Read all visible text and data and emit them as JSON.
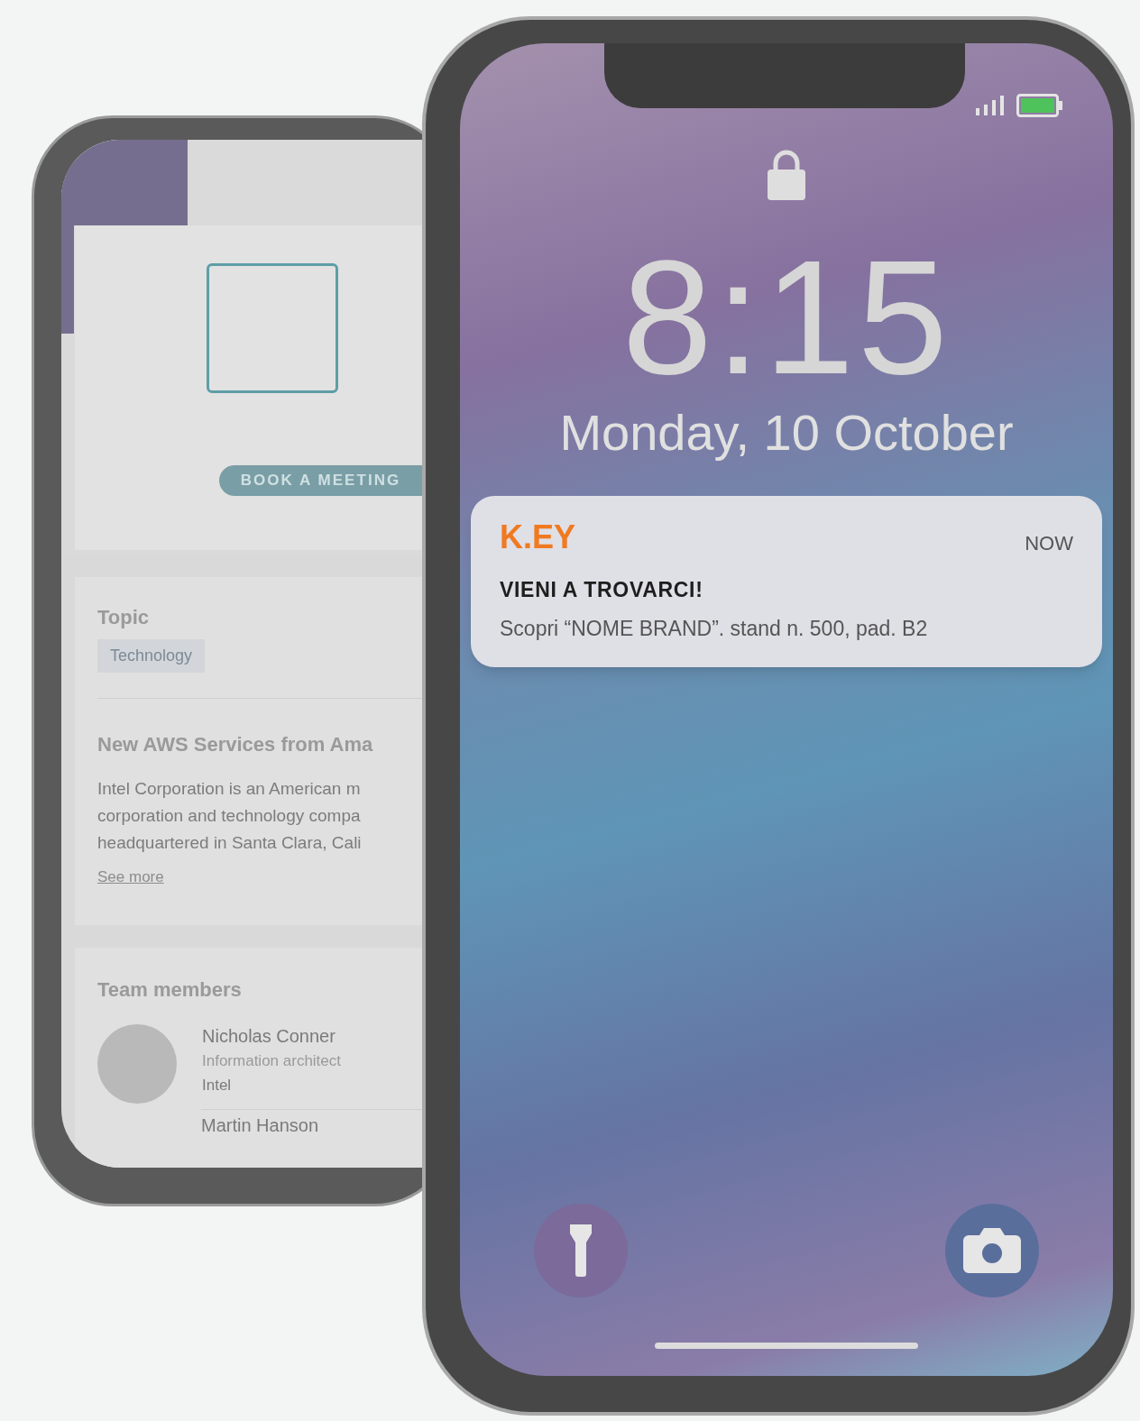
{
  "back_phone": {
    "button": "BOOK A MEETING",
    "topic": {
      "heading": "Topic",
      "tag": "Technology"
    },
    "article": {
      "title": "New AWS Services from Ama",
      "lines": [
        "Intel Corporation is an American m",
        "corporation and technology compa",
        "headquartered in Santa Clara, Cali"
      ],
      "link": "See more"
    },
    "team": {
      "heading": "Team members",
      "members": [
        {
          "name": "Nicholas Conner",
          "role": "Information architect",
          "company": "Intel"
        },
        {
          "name": "Martin Hanson"
        }
      ]
    }
  },
  "lock_screen": {
    "time": "8:15",
    "date": "Monday, 10 October",
    "notification": {
      "app": "K.EY",
      "time": "NOW",
      "title": "VIENI A TROVARCI!",
      "body": "Scopri “NOME BRAND”. stand n. 500, pad. B2"
    }
  }
}
